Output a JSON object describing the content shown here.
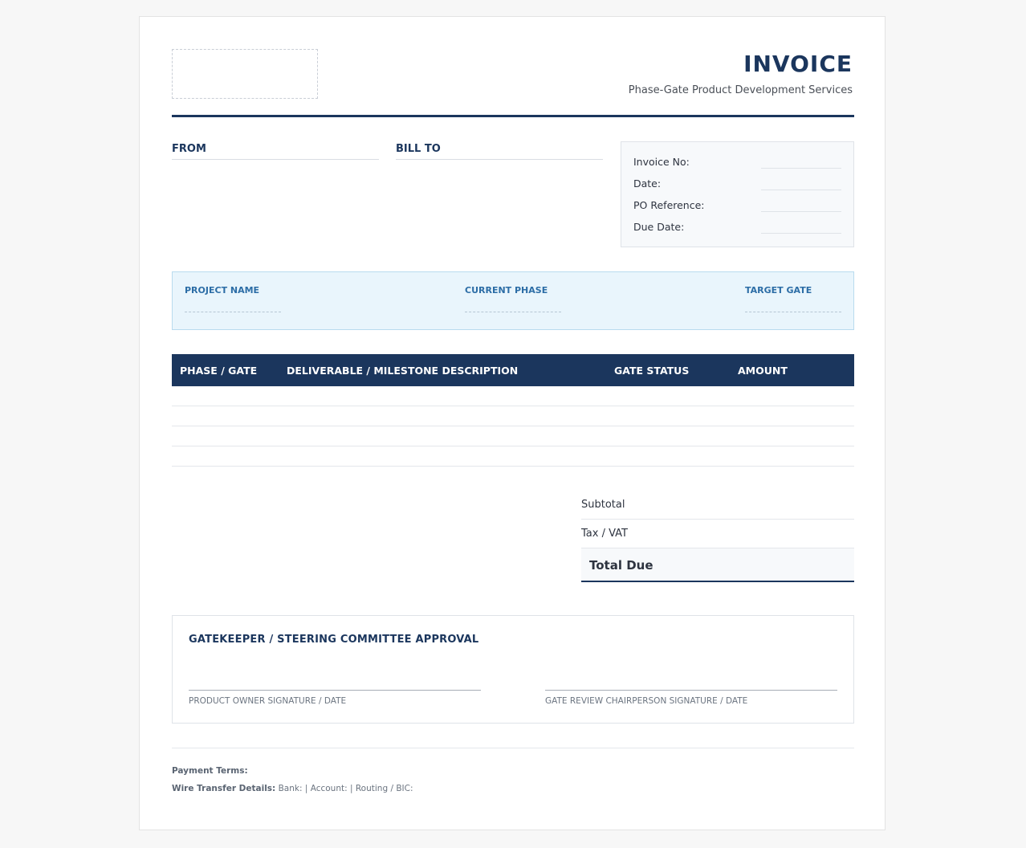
{
  "header": {
    "title": "INVOICE",
    "subtitle": "Phase-Gate Product Development Services"
  },
  "parties": {
    "from_label": "FROM",
    "bill_to_label": "BILL TO"
  },
  "meta": {
    "invoice_no_label": "Invoice No:",
    "date_label": "Date:",
    "po_reference_label": "PO Reference:",
    "due_date_label": "Due Date:"
  },
  "project": {
    "name_label": "PROJECT NAME",
    "phase_label": "CURRENT PHASE",
    "gate_label": "TARGET GATE"
  },
  "table": {
    "columns": [
      "PHASE / GATE",
      "DELIVERABLE / MILESTONE DESCRIPTION",
      "GATE STATUS",
      "AMOUNT"
    ]
  },
  "totals": {
    "subtotal_label": "Subtotal",
    "tax_label": "Tax / VAT",
    "total_label": "Total Due"
  },
  "approval": {
    "title": "GATEKEEPER / STEERING COMMITTEE APPROVAL",
    "sig_left_label": "PRODUCT OWNER SIGNATURE / DATE",
    "sig_right_label": "GATE REVIEW CHAIRPERSON SIGNATURE / DATE"
  },
  "footer": {
    "payment_terms_label": "Payment Terms:",
    "wire_label": "Wire Transfer Details:",
    "wire_value": "Bank: | Account: | Routing / BIC:"
  },
  "colors": {
    "brand_navy": "#1b365d",
    "project_band_bg": "#e9f5fc",
    "project_label": "#2c6da6"
  }
}
